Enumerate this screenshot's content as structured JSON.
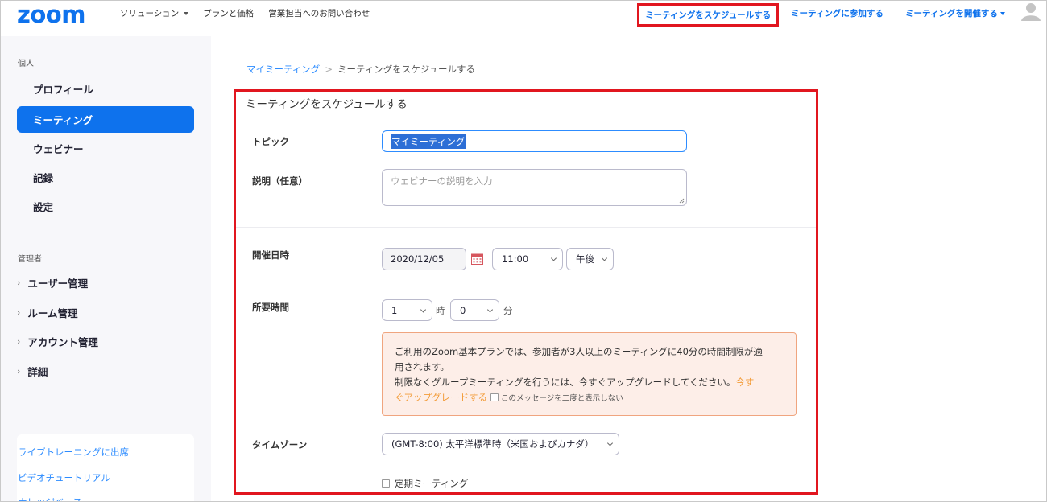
{
  "header": {
    "logo": "zoom",
    "nav_left": [
      "ソリューション",
      "プランと価格",
      "営業担当へのお問い合わせ"
    ],
    "schedule": "ミーティングをスケジュールする",
    "join": "ミーティングに参加する",
    "host": "ミーティングを開催する"
  },
  "sidebar": {
    "personal_heading": "個人",
    "personal_items": [
      "プロフィール",
      "ミーティング",
      "ウェビナー",
      "記録",
      "設定"
    ],
    "admin_heading": "管理者",
    "admin_items": [
      "ユーザー管理",
      "ルーム管理",
      "アカウント管理",
      "詳細"
    ],
    "links": [
      "ライブトレーニングに出席",
      "ビデオチュートリアル",
      "ナレッジベース"
    ]
  },
  "breadcrumb": {
    "parent": "マイミーティング",
    "separator": ">",
    "current": "ミーティングをスケジュールする"
  },
  "form": {
    "title": "ミーティングをスケジュールする",
    "topic_label": "トピック",
    "topic_value": "マイミーティング",
    "description_label": "説明（任意）",
    "description_placeholder": "ウェビナーの説明を入力",
    "when_label": "開催日時",
    "date_value": "2020/12/05",
    "time_value": "11:00",
    "ampm_value": "午後",
    "duration_label": "所要時間",
    "hours_value": "1",
    "hours_unit": "時",
    "minutes_value": "0",
    "minutes_unit": "分",
    "notice_line1": "ご利用のZoom基本プランでは、参加者が3人以上のミーティングに40分の時間制限が適",
    "notice_line2": "用されます。",
    "notice_line3": "制限なくグループミーティングを行うには、今すぐアップグレードしてください。",
    "notice_upgrade_a": "今す",
    "notice_upgrade_b": "ぐアップグレードする",
    "notice_dismiss": "このメッセージを二度と表示しない",
    "timezone_label": "タイムゾーン",
    "timezone_value": "(GMT-8:00) 太平洋標準時（米国およびカナダ）",
    "recurring_label": "定期ミーティング"
  },
  "colors": {
    "brand": "#0e72ed",
    "highlight_frame": "#e1161f",
    "notice_bg": "#fdeee8",
    "upgrade": "#f39c39"
  }
}
